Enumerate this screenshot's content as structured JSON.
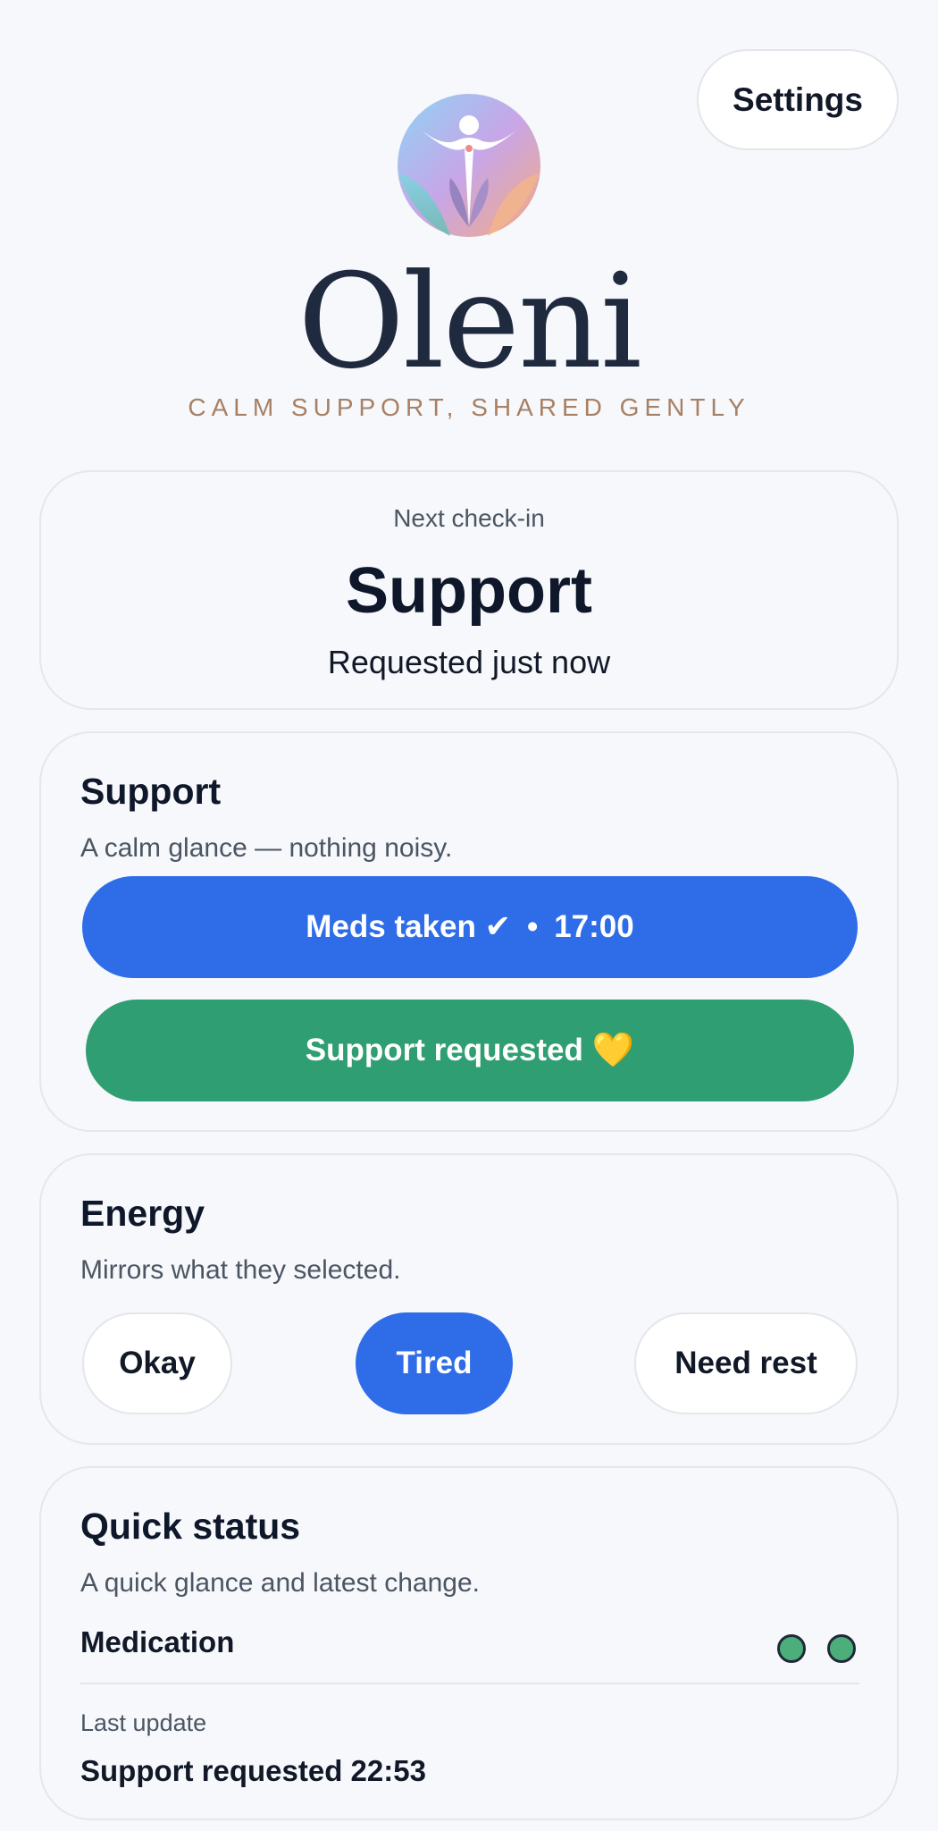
{
  "header": {
    "settings_label": "Settings",
    "brand_name": "Oleni",
    "tagline": "CALM SUPPORT, SHARED GENTLY",
    "logo_icon": "figure-lotus-logo"
  },
  "checkin": {
    "label": "Next check-in",
    "title": "Support",
    "subtitle": "Requested just now"
  },
  "support": {
    "title": "Support",
    "subtitle": "A calm glance — nothing noisy.",
    "meds_label": "Meds taken ✔",
    "meds_separator": "•",
    "meds_time": "17:00",
    "support_label": "Support requested",
    "support_emoji": "💛",
    "meds_color": "#2f6de8",
    "support_color": "#2f9e72"
  },
  "energy": {
    "title": "Energy",
    "subtitle": "Mirrors what they selected.",
    "options": [
      "Okay",
      "Tired",
      "Need rest"
    ],
    "selected": "Tired"
  },
  "quick_status": {
    "title": "Quick status",
    "subtitle": "A quick glance and latest change.",
    "row_label": "Medication",
    "status_dot_color": "#4cae7b",
    "last_update_label": "Last update",
    "last_update_value": "Support requested 22:53"
  }
}
